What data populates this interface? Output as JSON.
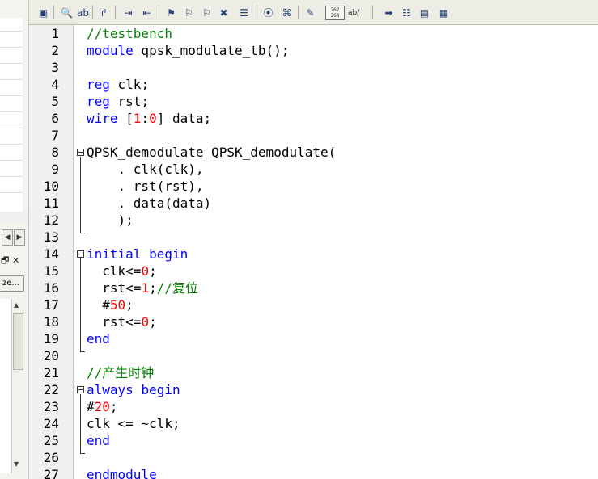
{
  "left_panel": {
    "scroll_left_arrow": "◀",
    "scroll_right_arrow": "▶",
    "restore_icon": "🗗",
    "close_icon": "✕",
    "size_button_label": "ze...",
    "scroll_up_arrow": "▲",
    "scroll_down_arrow": "▼"
  },
  "toolbar": {
    "icons": [
      {
        "name": "window-icon",
        "glyph": "▣"
      },
      {
        "name": "find-icon",
        "glyph": "🔍"
      },
      {
        "name": "replace-icon",
        "glyph": "ab"
      },
      {
        "name": "goto-icon",
        "glyph": "↱"
      },
      {
        "name": "indent-icon",
        "glyph": "⇥"
      },
      {
        "name": "outdent-icon",
        "glyph": "⇤"
      },
      {
        "name": "bookmark-icon",
        "glyph": "⚑"
      },
      {
        "name": "bookmark-next-icon",
        "glyph": "⚐"
      },
      {
        "name": "bookmark-prev-icon",
        "glyph": "⚐"
      },
      {
        "name": "bookmark-clear-icon",
        "glyph": "✖"
      },
      {
        "name": "bookmark-list-icon",
        "glyph": "☰"
      },
      {
        "name": "clip-icon",
        "glyph": "⦿"
      },
      {
        "name": "scroll-icon",
        "glyph": "⌘"
      },
      {
        "name": "spellcheck-icon",
        "glyph": "✎"
      },
      {
        "name": "arrow-right-icon",
        "glyph": "➡"
      },
      {
        "name": "list-icon",
        "glyph": "☷"
      },
      {
        "name": "panel-icon",
        "glyph": "▤"
      },
      {
        "name": "panel-active-icon",
        "glyph": "▦"
      }
    ],
    "line_count_top": "267",
    "line_count_bottom": "268",
    "ab_label": "ab/"
  },
  "editor": {
    "line_numbers": [
      "1",
      "2",
      "3",
      "4",
      "5",
      "6",
      "7",
      "8",
      "9",
      "10",
      "11",
      "12",
      "13",
      "14",
      "15",
      "16",
      "17",
      "18",
      "19",
      "20",
      "21",
      "22",
      "23",
      "24",
      "25",
      "26",
      "27"
    ],
    "lines": [
      [
        {
          "t": "//testbench",
          "c": "cm"
        }
      ],
      [
        {
          "t": "module",
          "c": "kw"
        },
        {
          "t": " qpsk_modulate_tb();",
          "c": "tx"
        }
      ],
      [],
      [
        {
          "t": "reg",
          "c": "kw"
        },
        {
          "t": " clk;",
          "c": "tx"
        }
      ],
      [
        {
          "t": "reg",
          "c": "kw"
        },
        {
          "t": " rst;",
          "c": "tx"
        }
      ],
      [
        {
          "t": "wire",
          "c": "kw"
        },
        {
          "t": " [",
          "c": "tx"
        },
        {
          "t": "1",
          "c": "num"
        },
        {
          "t": ":",
          "c": "tx"
        },
        {
          "t": "0",
          "c": "num"
        },
        {
          "t": "] data;",
          "c": "tx"
        }
      ],
      [],
      [
        {
          "t": "QPSK_demodulate QPSK_demodulate(",
          "c": "tx"
        }
      ],
      [
        {
          "t": "    . clk(clk),",
          "c": "tx"
        }
      ],
      [
        {
          "t": "    . rst(rst),",
          "c": "tx"
        }
      ],
      [
        {
          "t": "    . data(data)",
          "c": "tx"
        }
      ],
      [
        {
          "t": "    );",
          "c": "tx"
        }
      ],
      [],
      [
        {
          "t": "initial",
          "c": "kw"
        },
        {
          "t": " ",
          "c": "tx"
        },
        {
          "t": "begin",
          "c": "kw"
        }
      ],
      [
        {
          "t": "  clk<=",
          "c": "tx"
        },
        {
          "t": "0",
          "c": "num"
        },
        {
          "t": ";",
          "c": "tx"
        }
      ],
      [
        {
          "t": "  rst<=",
          "c": "tx"
        },
        {
          "t": "1",
          "c": "num"
        },
        {
          "t": ";",
          "c": "tx"
        },
        {
          "t": "//复位",
          "c": "cm"
        }
      ],
      [
        {
          "t": "  #",
          "c": "tx"
        },
        {
          "t": "50",
          "c": "num"
        },
        {
          "t": ";",
          "c": "tx"
        }
      ],
      [
        {
          "t": "  rst<=",
          "c": "tx"
        },
        {
          "t": "0",
          "c": "num"
        },
        {
          "t": ";",
          "c": "tx"
        }
      ],
      [
        {
          "t": "end",
          "c": "kw"
        }
      ],
      [],
      [
        {
          "t": "//产生时钟",
          "c": "cm"
        }
      ],
      [
        {
          "t": "always",
          "c": "kw"
        },
        {
          "t": " ",
          "c": "tx"
        },
        {
          "t": "begin",
          "c": "kw"
        }
      ],
      [
        {
          "t": "#",
          "c": "tx"
        },
        {
          "t": "20",
          "c": "num"
        },
        {
          "t": ";",
          "c": "tx"
        }
      ],
      [
        {
          "t": "clk <= ~clk;",
          "c": "tx"
        }
      ],
      [
        {
          "t": "end",
          "c": "kw"
        }
      ],
      [],
      [
        {
          "t": "endmodule",
          "c": "kw"
        }
      ]
    ]
  }
}
